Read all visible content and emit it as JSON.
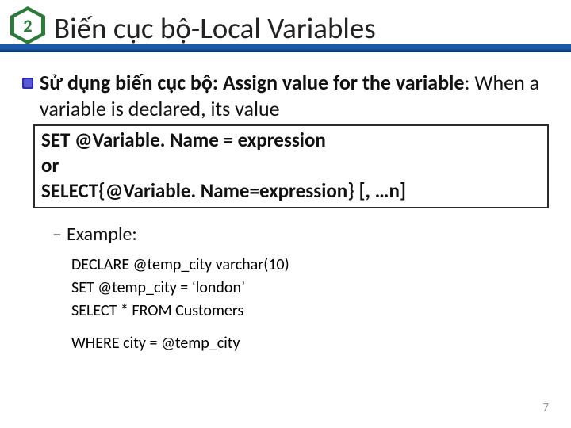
{
  "header": {
    "badge_number": "2",
    "title": "Biến cục bộ-Local Variables"
  },
  "bullet": {
    "lead_bold": "Sử dụng biến cục bộ: Assign value for the variable",
    "lead_rest": ": When a variable is declared, its value"
  },
  "syntax": {
    "line1": "SET @Variable. Name = expression",
    "line2": "or",
    "line3": "SELECT{@Variable. Name=expression} [, …n]"
  },
  "example_label": "Example:",
  "code": {
    "l1": "DECLARE  @temp_city  varchar(10)",
    "l2": "SET  @temp_city  = ‘london’",
    "l3": "SELECT * FROM  Customers",
    "l4": "WHERE   city = @temp_city"
  },
  "page_number": "7"
}
